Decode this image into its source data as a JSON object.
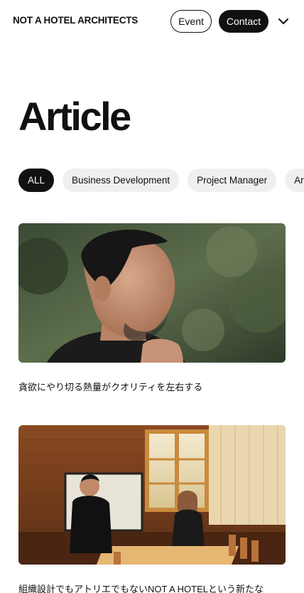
{
  "header": {
    "brand": "NOT A HOTEL ARCHITECTS",
    "event_label": "Event",
    "contact_label": "Contact",
    "menu_icon": "chevron-down-icon"
  },
  "page": {
    "title": "Article"
  },
  "filters": {
    "items": [
      {
        "label": "ALL",
        "active": true
      },
      {
        "label": "Business Development",
        "active": false
      },
      {
        "label": "Project Manager",
        "active": false
      },
      {
        "label": "Ar",
        "active": false
      }
    ]
  },
  "articles": [
    {
      "title": "貪欲にやり切る熱量がクオリティを左右する"
    },
    {
      "title": "組織設計でもアトリエでもないNOT A HOTELという新たな"
    }
  ],
  "colors": {
    "accent": "#111111",
    "chip_bg": "#efefef",
    "background": "#ffffff"
  }
}
